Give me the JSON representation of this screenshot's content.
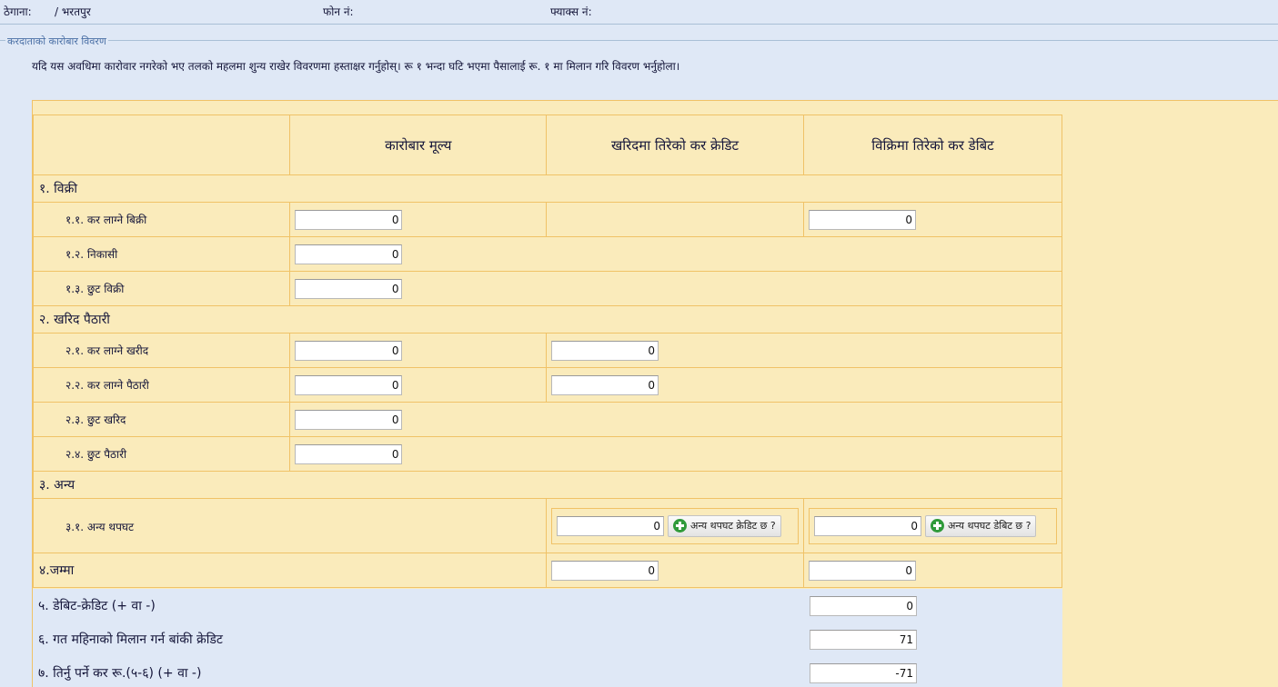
{
  "header": {
    "address_label": "ठेगाना:",
    "address_value": "/ भरतपुर",
    "phone_label": "फोन नं:",
    "fax_label": "फ्याक्स नं:"
  },
  "section_title": "करदाताको कारोबार विवरण",
  "instruction": "यदि यस अवधिमा कारोवार नगरेको भए तलको महलमा शुन्य राखेर विवरणमा हस्ताक्षर गर्नुहोस्। रू १ भन्दा घटि भएमा पैसालाई रू. १ मा मिलान गरि विवरण भर्नुहोला।",
  "columns": {
    "value": "कारोबार मूल्य",
    "credit": "खरिदमा तिरेको कर क्रेडिट",
    "debit": "विक्रिमा तिरेको कर डेबिट"
  },
  "sales": {
    "title": "१. विक्री",
    "taxable": {
      "label": "१.१. कर लाग्ने बिक्री",
      "value": "0",
      "debit": "0"
    },
    "export": {
      "label": "१.२. निकासी",
      "value": "0"
    },
    "exempt": {
      "label": "१.३. छुट विक्री",
      "value": "0"
    }
  },
  "purchase": {
    "title": "२. खरिद पैठारी",
    "taxable_purchase": {
      "label": "२.१. कर लाग्ने खरीद",
      "value": "0",
      "credit": "0"
    },
    "taxable_import": {
      "label": "२.२. कर लाग्ने पैठारी",
      "value": "0",
      "credit": "0"
    },
    "exempt_purchase": {
      "label": "२.३. छुट खरिद",
      "value": "0"
    },
    "exempt_import": {
      "label": "२.४. छुट पैठारी",
      "value": "0"
    }
  },
  "other": {
    "title": "३. अन्य",
    "adjust": {
      "label": "३.१. अन्य थपघट",
      "credit": "0",
      "debit": "0",
      "credit_button": "अन्य थपघट क्रेडिट छ ?",
      "debit_button": "अन्य थपघट डेबिट छ ?"
    }
  },
  "total": {
    "label": "४.जम्मा",
    "credit": "0",
    "debit": "0"
  },
  "summary": {
    "diff": {
      "label": "५. डेबिट-क्रेडिट (+ वा -)",
      "value": "0"
    },
    "prev_credit": {
      "label": "६. गत महिनाको मिलान गर्न बांकी क्रेडिट",
      "value": "71"
    },
    "payable": {
      "label": "७. तिर्नु पर्ने कर रू.(५-६) (+ वा -)",
      "value": "-71"
    }
  }
}
